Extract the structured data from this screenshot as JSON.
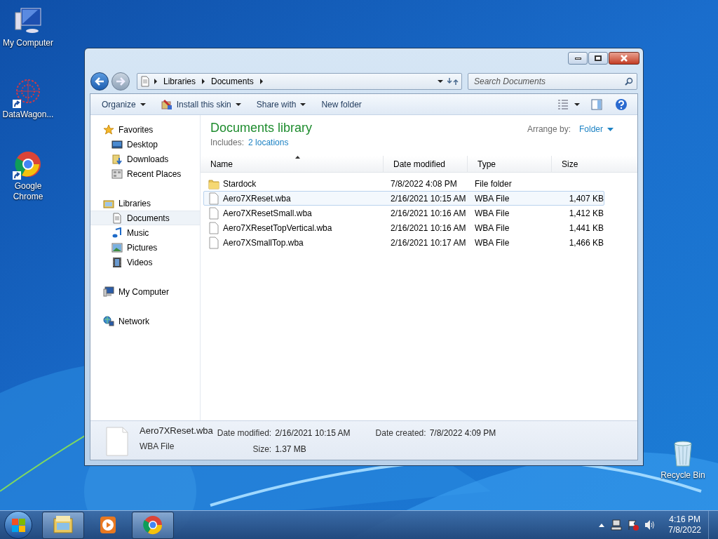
{
  "desktop_icons": [
    {
      "label": "My Computer",
      "kind": "computer",
      "shortcut": false
    },
    {
      "label": "DataWagon...",
      "kind": "web",
      "shortcut": true
    },
    {
      "label": "Google Chrome",
      "kind": "chrome",
      "shortcut": true
    },
    {
      "label": "Recycle Bin",
      "kind": "bin",
      "shortcut": false
    }
  ],
  "window": {
    "address": {
      "crumbs": [
        "Libraries",
        "Documents"
      ]
    },
    "search": {
      "placeholder": "Search Documents"
    },
    "toolbar": [
      {
        "label": "Organize",
        "kind": "menu"
      },
      {
        "label": "Install this skin",
        "kind": "skin"
      },
      {
        "label": "Share with",
        "kind": "menu"
      },
      {
        "label": "New folder",
        "kind": "plain"
      }
    ],
    "nav": [
      {
        "label": "Favorites",
        "kind": "star",
        "selected": false,
        "children": [
          {
            "label": "Desktop",
            "kind": "desktop",
            "selected": false
          },
          {
            "label": "Downloads",
            "kind": "downloads",
            "selected": false
          },
          {
            "label": "Recent Places",
            "kind": "recent",
            "selected": false
          }
        ]
      },
      {
        "label": "Libraries",
        "kind": "library",
        "selected": false,
        "children": [
          {
            "label": "Documents",
            "kind": "document",
            "selected": true
          },
          {
            "label": "Music",
            "kind": "music",
            "selected": false
          },
          {
            "label": "Pictures",
            "kind": "pictures",
            "selected": false
          },
          {
            "label": "Videos",
            "kind": "videos",
            "selected": false
          }
        ]
      },
      {
        "label": "My Computer",
        "kind": "computer",
        "selected": false
      },
      {
        "label": "Network",
        "kind": "network",
        "selected": false
      }
    ],
    "library": {
      "title": "Documents library",
      "includes_label": "Includes:",
      "locations": "2 locations",
      "arrange_label": "Arrange by:",
      "arrange_value": "Folder"
    },
    "columns": [
      "Name",
      "Date modified",
      "Type",
      "Size"
    ],
    "rows": [
      {
        "kind": "folder",
        "name": "Stardock",
        "date": "7/8/2022 4:08 PM",
        "type": "File folder",
        "selected": false
      },
      {
        "kind": "file",
        "name": "Aero7XReset.wba",
        "date": "2/16/2021 10:15 AM",
        "type": "WBA File",
        "size": "1,407 KB",
        "selected": true
      },
      {
        "kind": "file",
        "name": "Aero7XResetSmall.wba",
        "date": "2/16/2021 10:16 AM",
        "type": "WBA File",
        "size": "1,412 KB",
        "selected": false
      },
      {
        "kind": "file",
        "name": "Aero7XResetTopVertical.wba",
        "date": "2/16/2021 10:16 AM",
        "type": "WBA File",
        "size": "1,441 KB",
        "selected": false
      },
      {
        "kind": "file",
        "name": "Aero7XSmallTop.wba",
        "date": "2/16/2021 10:17 AM",
        "type": "WBA File",
        "size": "1,466 KB",
        "selected": false
      }
    ],
    "details": {
      "name": "Aero7XReset.wba",
      "type": "WBA File",
      "modified_label": "Date modified:",
      "modified": "2/16/2021 10:15 AM",
      "size_label": "Size:",
      "size": "1.37 MB",
      "created_label": "Date created:",
      "created": "7/8/2022 4:09 PM"
    }
  },
  "taskbar": {
    "apps": [
      {
        "kind": "explorer",
        "running": true
      },
      {
        "kind": "media",
        "running": false
      },
      {
        "kind": "chrome",
        "running": true
      }
    ],
    "time": "4:16 PM",
    "date": "7/8/2022"
  }
}
